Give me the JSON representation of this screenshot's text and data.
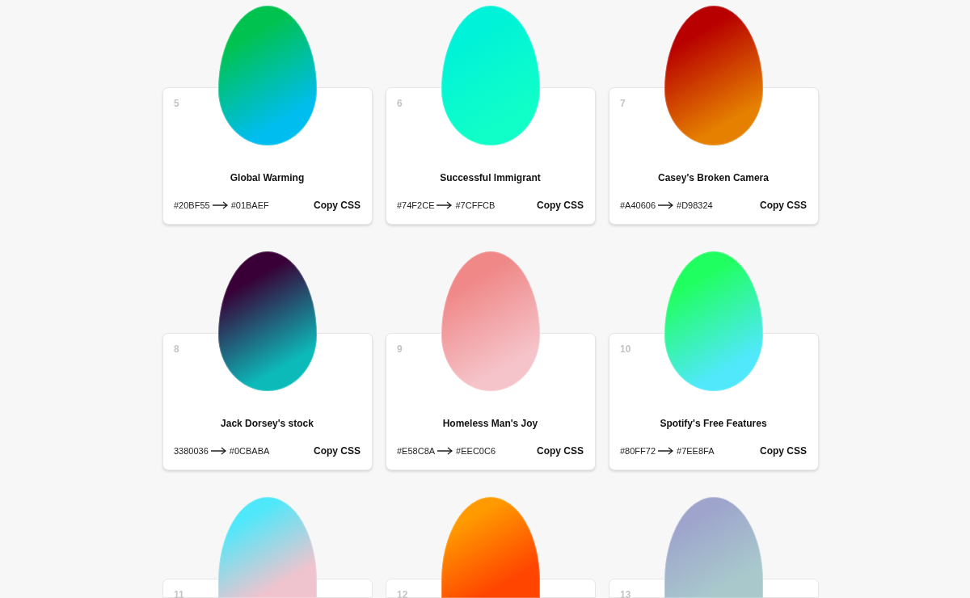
{
  "cards": [
    {
      "number": "5",
      "title": "Global Warming",
      "from": "#20BF55",
      "to": "#01BAEF",
      "color": "#00c24f",
      "gradient_end": {
        "color": "#00bdf0"
      },
      "action": "Copy CSS"
    },
    {
      "number": "6",
      "title": "Successful Immigrant",
      "from": "#74F2CE",
      "to": "#7CFFCB",
      "color": "#00f2d8",
      "gradient_end": {
        "color": "#10ffc8"
      },
      "action": "Copy CSS"
    },
    {
      "number": "7",
      "title": "Casey's Broken Camera",
      "from": "#A40606",
      "to": "#D98324",
      "color": "#b80000",
      "gradient_end": {
        "color": "#e58000"
      },
      "action": "Copy CSS"
    },
    {
      "number": "8",
      "title": "Jack Dorsey's stock",
      "from": "3380036",
      "to": "#0CBABA",
      "color": "#380036",
      "gradient_end": {
        "color": "#0cbaba"
      },
      "action": "Copy CSS"
    },
    {
      "number": "9",
      "title": "Homeless Man's Joy",
      "from": "#E58C8A",
      "to": "#EEC0C6",
      "color": "#f08888",
      "gradient_end": {
        "color": "#f5c4ca"
      },
      "action": "Copy CSS"
    },
    {
      "number": "10",
      "title": "Spotify's Free Features",
      "from": "#80FF72",
      "to": "#7EE8FA",
      "color": "#20ff60",
      "gradient_end": {
        "color": "#50e8fa"
      },
      "action": "Copy CSS"
    },
    {
      "number": "11",
      "color": "#4fe8fa",
      "gradient_end": {
        "color": "#efc4ce"
      }
    },
    {
      "number": "12",
      "color": "#ff9a00",
      "gradient_end": {
        "color": "#ff4500"
      }
    },
    {
      "number": "13",
      "color": "#9ea4cc",
      "gradient_end": {
        "color": "#a8c8cc"
      }
    }
  ]
}
